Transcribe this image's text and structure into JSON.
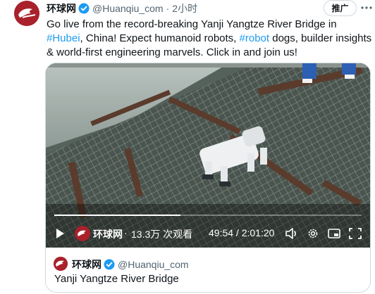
{
  "tweet": {
    "account_name": "环球网",
    "handle": "@Huanqiu_com",
    "separator": "·",
    "time": "2小时",
    "promo_label": "推广",
    "text_part1": "Go live from the record-breaking Yanji Yangtze River Bridge in ",
    "hashtag1": "#Hubei",
    "text_part2": ", China! Expect humanoid robots, ",
    "hashtag2": "#robot",
    "text_part3": " dogs, builder insights & world-first engineering marvels. Click in and join us!"
  },
  "video": {
    "channel_name": "环球网",
    "separator": "·",
    "views": "13.3万 次观看",
    "time_display": "49:54 / 2:01:20",
    "progress": 0.411
  },
  "source_card": {
    "account_name": "环球网",
    "handle": "@Huanqiu_com",
    "title": "Yanji Yangtze River Bridge"
  },
  "colors": {
    "link": "#1d9bf0",
    "brand": "#a8212b",
    "verified": "#1d9bf0"
  },
  "icons": [
    "verified-badge-icon",
    "more-icon",
    "play-icon",
    "volume-icon",
    "settings-icon",
    "pip-icon",
    "fullscreen-icon"
  ]
}
